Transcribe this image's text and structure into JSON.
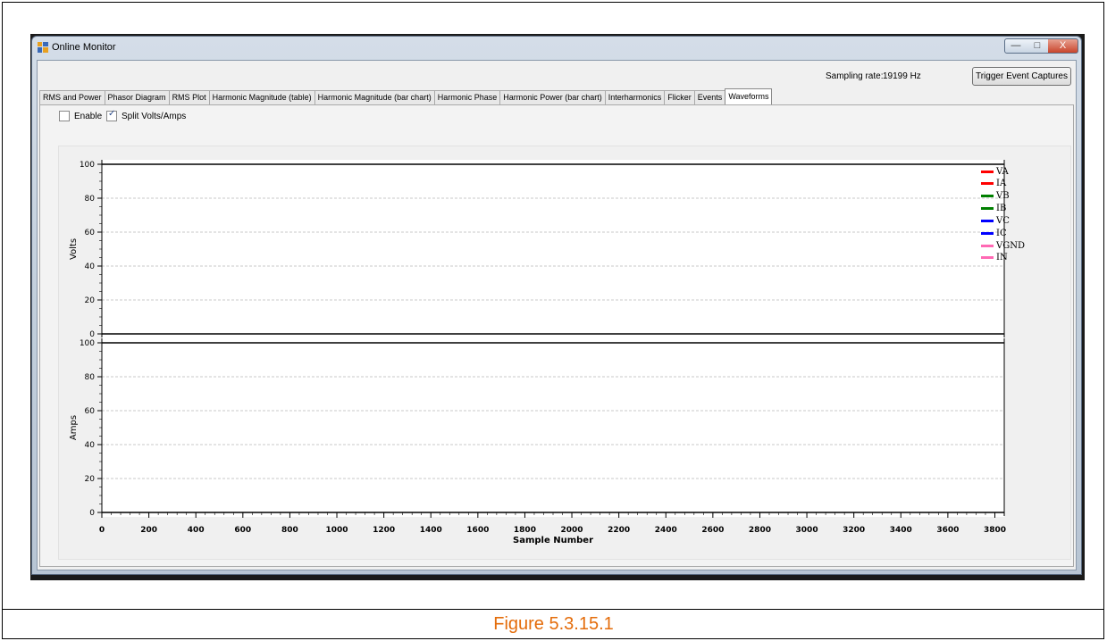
{
  "window": {
    "title": "Online Monitor",
    "controls": {
      "minimize": "—",
      "maximize": "□",
      "close": "X"
    }
  },
  "header": {
    "sampling_rate_label": "Sampling rate:",
    "sampling_rate_value": "19199 Hz",
    "trigger_button": "Trigger Event Captures"
  },
  "tabs": [
    {
      "label": "RMS and Power"
    },
    {
      "label": "Phasor Diagram"
    },
    {
      "label": "RMS Plot"
    },
    {
      "label": "Harmonic Magnitude (table)"
    },
    {
      "label": "Harmonic Magnitude (bar chart)"
    },
    {
      "label": "Harmonic Phase"
    },
    {
      "label": "Harmonic Power (bar chart)"
    },
    {
      "label": "Interharmonics"
    },
    {
      "label": "Flicker"
    },
    {
      "label": "Events"
    },
    {
      "label": "Waveforms",
      "active": true
    }
  ],
  "options": {
    "enable": {
      "label": "Enable",
      "checked": false
    },
    "split": {
      "label": "Split Volts/Amps",
      "checked": true
    }
  },
  "legend": [
    {
      "label": "VA",
      "color": "#ff0000"
    },
    {
      "label": "IA",
      "color": "#ff0000"
    },
    {
      "label": "VB",
      "color": "#008000"
    },
    {
      "label": "IB",
      "color": "#008000"
    },
    {
      "label": "VC",
      "color": "#0000ff"
    },
    {
      "label": "IC",
      "color": "#0000ff"
    },
    {
      "label": "VGND",
      "color": "#ff69b4"
    },
    {
      "label": "IN",
      "color": "#ff69b4"
    }
  ],
  "caption": "Figure 5.3.15.1",
  "chart_data": [
    {
      "type": "line",
      "ylabel": "Volts",
      "xlabel": "",
      "ylim": [
        0,
        100
      ],
      "yticks": [
        "0",
        "20",
        "40",
        "60",
        "80",
        "100"
      ],
      "xlim": [
        0,
        3840
      ],
      "grid": true,
      "series": []
    },
    {
      "type": "line",
      "ylabel": "Amps",
      "xlabel": "Sample Number",
      "ylim": [
        0,
        100
      ],
      "yticks": [
        "0",
        "20",
        "40",
        "60",
        "80",
        "100"
      ],
      "xlim": [
        0,
        3840
      ],
      "xticks": [
        "0",
        "200",
        "400",
        "600",
        "800",
        "1000",
        "1200",
        "1400",
        "1600",
        "1800",
        "2000",
        "2200",
        "2400",
        "2600",
        "2800",
        "3000",
        "3200",
        "3400",
        "3600",
        "3800"
      ],
      "grid": true,
      "series": []
    }
  ]
}
